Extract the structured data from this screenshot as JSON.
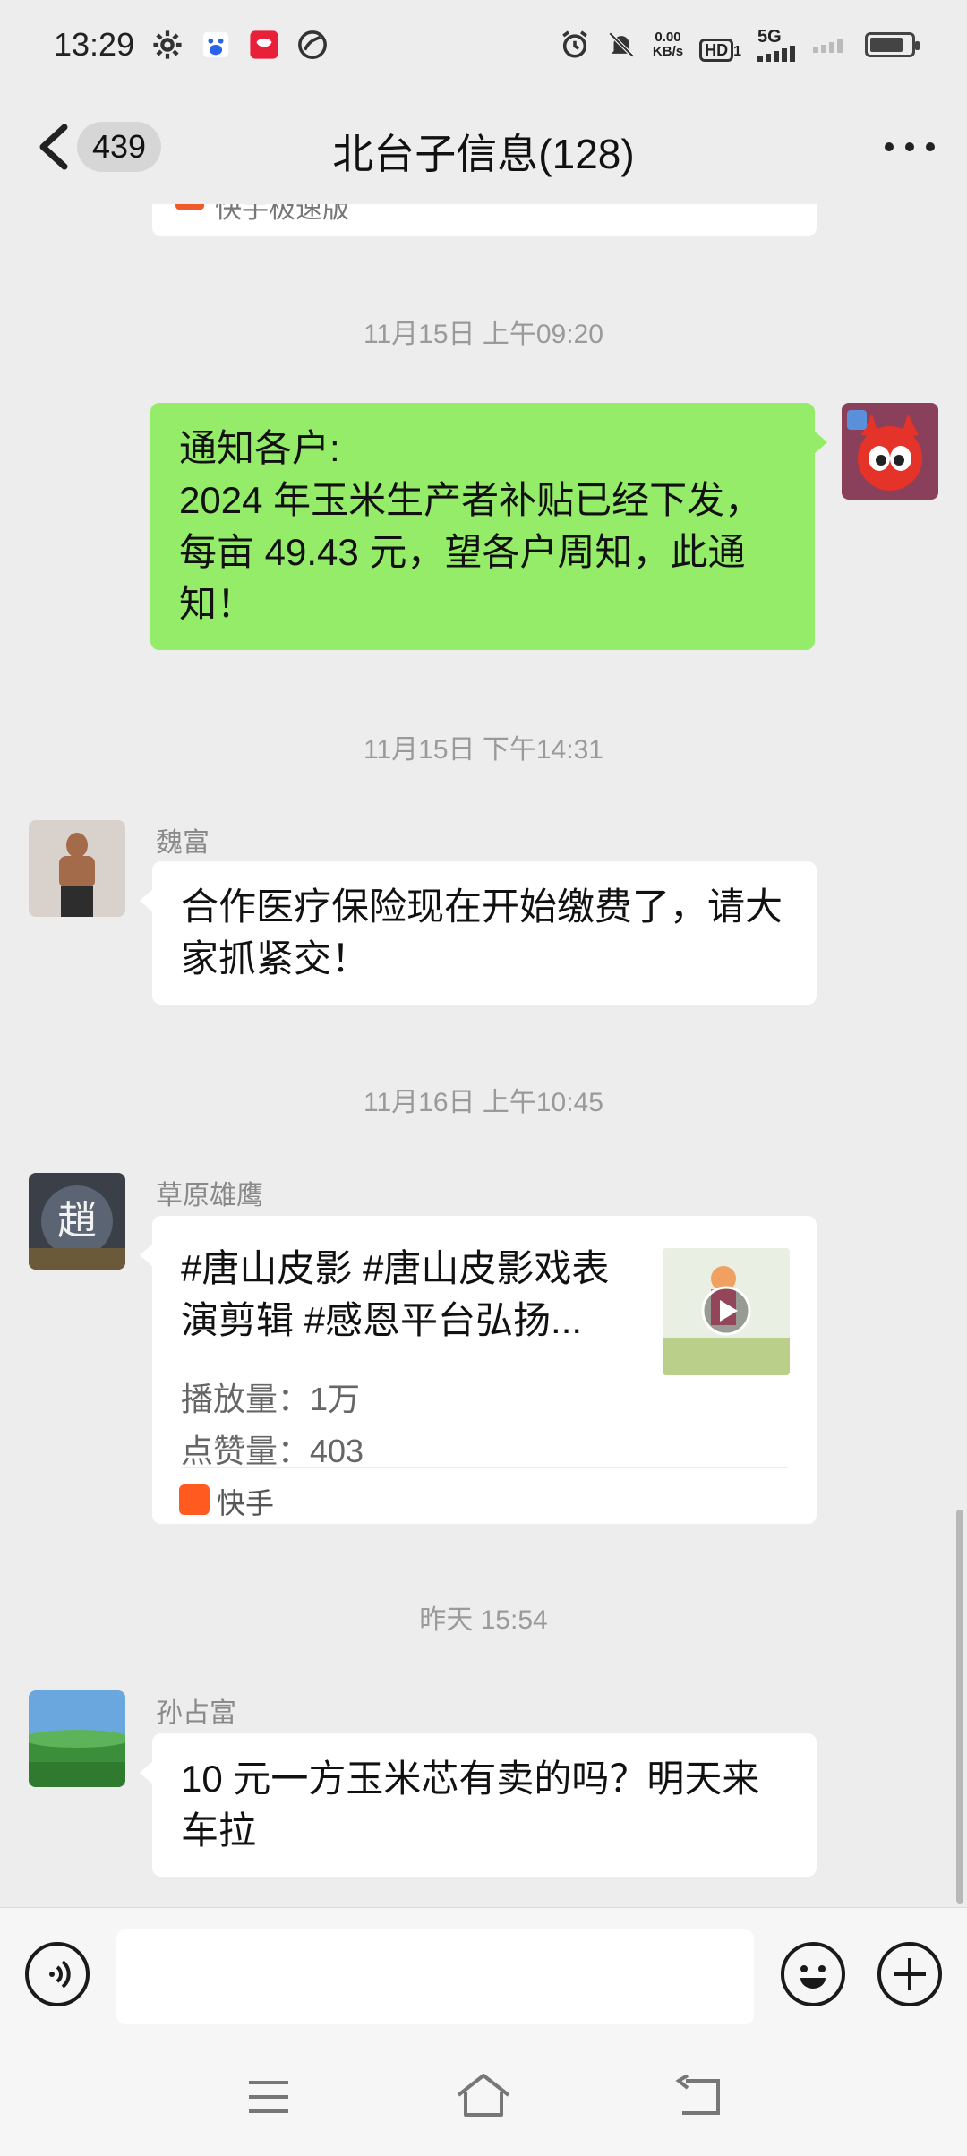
{
  "status_bar": {
    "time": "13:29",
    "net_speed_value": "0.00",
    "net_speed_unit": "KB/s",
    "hd_label": "HD",
    "hd_sub": "1",
    "network_label": "5G",
    "battery_level": 0.82
  },
  "nav": {
    "unread_count": "439",
    "title": "北台子信息(128)"
  },
  "partial_card": {
    "source_label": "快手极速版"
  },
  "messages": [
    {
      "timestamp": "11月15日 上午09:20",
      "mine": true,
      "text": "通知各户:\n2024 年玉米生产者补贴已经下发，每亩 49.43 元，望各户周知，此通知！"
    },
    {
      "timestamp": "11月15日 下午14:31",
      "sender": "魏富",
      "text": "合作医疗保险现在开始缴费了，请大家抓紧交！"
    },
    {
      "timestamp": "11月16日 上午10:45",
      "sender": "草原雄鹰",
      "video_card": {
        "title": "#唐山皮影 #唐山皮影戏表演剪辑 #感恩平台弘扬...",
        "plays": "播放量：1万",
        "likes": "点赞量：403",
        "source": "快手"
      }
    },
    {
      "timestamp": "昨天 15:54",
      "sender": "孙占富",
      "text": "10 元一方玉米芯有卖的吗？明天来车拉"
    }
  ],
  "input": {
    "placeholder": ""
  },
  "colors": {
    "background": "#ededed",
    "my_bubble": "#95ec69",
    "other_bubble": "#ffffff",
    "timestamp_text": "#9a9a9a",
    "kuaishou_orange": "#ff5a1f"
  }
}
